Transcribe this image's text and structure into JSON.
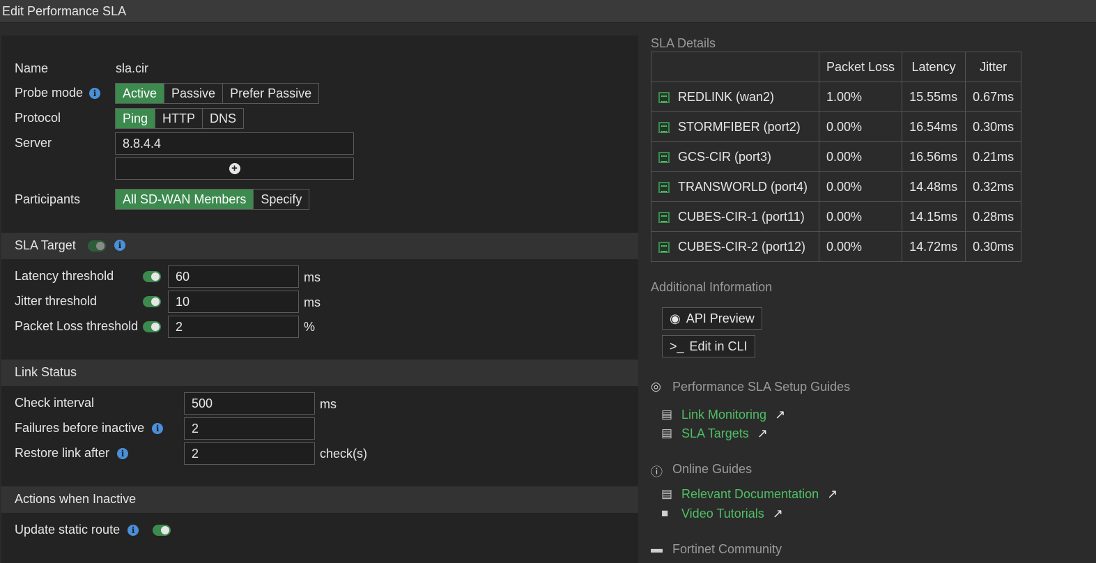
{
  "title": "Edit Performance SLA",
  "form": {
    "name_label": "Name",
    "name_value": "sla.cir",
    "probe_label": "Probe mode",
    "probe_options": [
      "Active",
      "Passive",
      "Prefer Passive"
    ],
    "probe_selected": "Active",
    "protocol_label": "Protocol",
    "protocol_options": [
      "Ping",
      "HTTP",
      "DNS"
    ],
    "protocol_selected": "Ping",
    "server_label": "Server",
    "server_value": "8.8.4.4",
    "participants_label": "Participants",
    "participants_options": [
      "All SD-WAN Members",
      "Specify"
    ],
    "participants_selected": "All SD-WAN Members"
  },
  "sla_target": {
    "title": "SLA Target",
    "latency_label": "Latency threshold",
    "latency_value": "60",
    "latency_unit": "ms",
    "jitter_label": "Jitter threshold",
    "jitter_value": "10",
    "jitter_unit": "ms",
    "loss_label": "Packet Loss threshold",
    "loss_value": "2",
    "loss_unit": "%"
  },
  "link_status": {
    "title": "Link Status",
    "check_label": "Check interval",
    "check_value": "500",
    "check_unit": "ms",
    "failures_label": "Failures before inactive",
    "failures_value": "2",
    "restore_label": "Restore link after",
    "restore_value": "2",
    "restore_unit": "check(s)"
  },
  "actions": {
    "title": "Actions when Inactive",
    "update_label": "Update static route"
  },
  "sla_details": {
    "title": "SLA Details",
    "columns": [
      "",
      "Packet Loss",
      "Latency",
      "Jitter"
    ],
    "rows": [
      {
        "name": "REDLINK (wan2)",
        "loss": "1.00%",
        "latency": "15.55ms",
        "jitter": "0.67ms"
      },
      {
        "name": "STORMFIBER (port2)",
        "loss": "0.00%",
        "latency": "16.54ms",
        "jitter": "0.30ms"
      },
      {
        "name": "GCS-CIR (port3)",
        "loss": "0.00%",
        "latency": "16.56ms",
        "jitter": "0.21ms"
      },
      {
        "name": "TRANSWORLD (port4)",
        "loss": "0.00%",
        "latency": "14.48ms",
        "jitter": "0.32ms"
      },
      {
        "name": "CUBES-CIR-1 (port11)",
        "loss": "0.00%",
        "latency": "14.15ms",
        "jitter": "0.28ms"
      },
      {
        "name": "CUBES-CIR-2 (port12)",
        "loss": "0.00%",
        "latency": "14.72ms",
        "jitter": "0.30ms"
      }
    ]
  },
  "additional": {
    "title": "Additional Information",
    "api_preview": "API Preview",
    "edit_cli": "Edit in CLI",
    "setup_guides_title": "Performance SLA Setup Guides",
    "link_monitoring": "Link Monitoring",
    "sla_targets": "SLA Targets",
    "online_guides_title": "Online Guides",
    "relevant_docs": "Relevant Documentation",
    "video_tutorials": "Video Tutorials",
    "community_title": "Fortinet Community"
  },
  "colors": {
    "accent_green": "#3c8a4e",
    "link_green": "#4fbf64",
    "info_blue": "#4a90d9"
  }
}
